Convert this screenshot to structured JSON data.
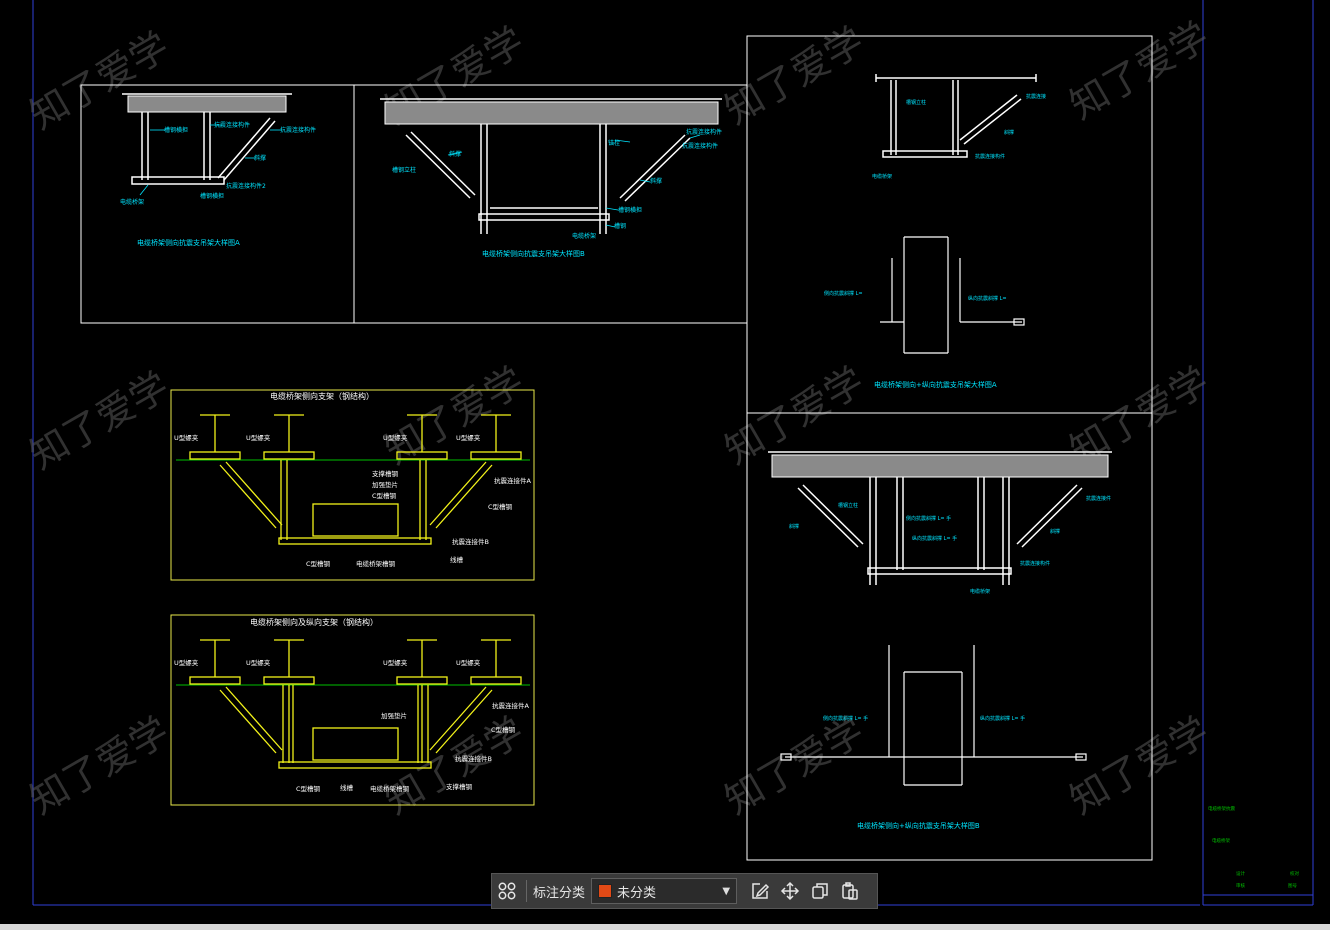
{
  "colors": {
    "background": "#000000",
    "frame": "#2f3fd9",
    "panel_border": "#ffffff",
    "yellow_border": "#e8e84a",
    "structure": "#ffffff",
    "slab_fill": "#9a9a9a",
    "cyan_label": "#00e5ff",
    "green_line": "#00c000",
    "yellow_drawing": "#f2f21a",
    "watermark": "#5a5a5a"
  },
  "watermark_text": "知了爱学",
  "panels": {
    "a": {
      "caption": "电缆桥架侧向抗震支吊架大样图A",
      "labels": [
        "槽钢横担",
        "抗震连接构件",
        "斜撑",
        "抗震连接构件2",
        "电缆桥架",
        "槽钢横担"
      ]
    },
    "b": {
      "caption": "电缆桥架侧向抗震支吊架大样图B",
      "labels": [
        "锚栓",
        "斜撑",
        "槽钢立柱",
        "抗震连接构件",
        "电缆桥架",
        "抗震连接构件",
        "槽钢横担",
        "斜撑",
        "槽钢"
      ]
    },
    "c": {
      "caption": "电缆桥架侧向+纵向抗震支吊架大样图A",
      "labels": [
        "槽钢立柱",
        "抗震连接",
        "斜撑",
        "抗震连接构件",
        "电缆桥架",
        "侧向抗震斜撑 L=",
        "纵向抗震斜撑 L="
      ]
    },
    "d": {
      "caption": "电缆桥架侧向+纵向抗震支吊架大样图B",
      "labels": [
        "槽钢立柱",
        "抗震连接件",
        "斜撑",
        "抗震连接构件",
        "斜撑",
        "侧向抗震斜撑 L= 手",
        "纵向抗震斜撑 L= 手",
        "电缆桥架",
        "侧向抗震斜撑 L= 手",
        "纵向抗震斜撑 L= 手"
      ]
    },
    "e": {
      "title": "电缆桥架侧向支架（钢结构）",
      "labels": [
        "U型螺夹",
        "U型螺夹",
        "U型螺夹",
        "U型螺夹",
        "支撑槽钢",
        "加强垫片",
        "C型槽钢",
        "抗震连接件A",
        "C型槽钢",
        "抗震连接件B",
        "C型槽钢",
        "电缆桥架槽钢",
        "线槽"
      ]
    },
    "f": {
      "title": "电缆桥架侧向及纵向支架（钢结构）",
      "labels": [
        "U型螺夹",
        "U型螺夹",
        "U型螺夹",
        "U型螺夹",
        "加强垫片",
        "抗震连接件A",
        "C型槽钢",
        "抗震连接件B",
        "C型槽钢",
        "线槽",
        "电缆桥架槽钢",
        "支撑槽钢"
      ]
    }
  },
  "titleblock": {
    "texts": [
      "电缆桥架抗震",
      "电缆桥架",
      "设计",
      "审核",
      "校对",
      "图号"
    ]
  },
  "toolbar": {
    "category_label": "标注分类",
    "category_value": "未分类",
    "category_color": "#e24a16",
    "icons": [
      "grid-icon",
      "edit-icon",
      "move-icon",
      "copy-icon",
      "paste-icon"
    ]
  }
}
